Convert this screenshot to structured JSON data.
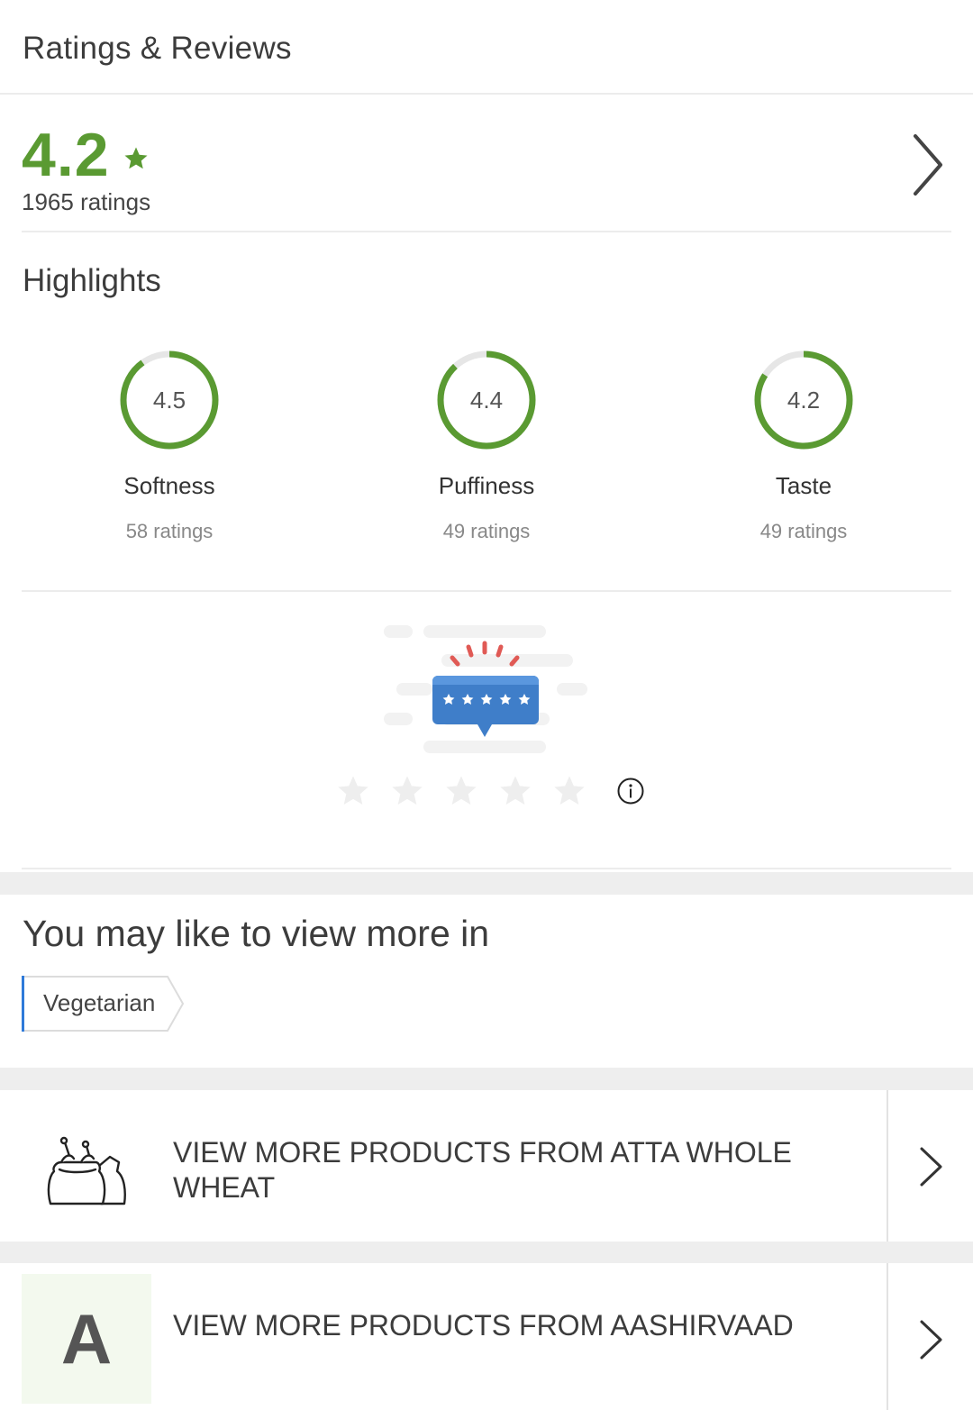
{
  "header": {
    "title": "Ratings & Reviews"
  },
  "overall": {
    "score": "4.2",
    "ratings_count": "1965 ratings",
    "star_icon": "star-icon",
    "chevron_icon": "chevron-right-icon"
  },
  "highlights": {
    "title": "Highlights",
    "items": [
      {
        "value": "4.5",
        "label": "Softness",
        "count": "58 ratings",
        "level": 0.9
      },
      {
        "value": "4.4",
        "label": "Puffiness",
        "count": "49 ratings",
        "level": 0.88
      },
      {
        "value": "4.2",
        "label": "Taste",
        "count": "49 ratings",
        "level": 0.84
      }
    ]
  },
  "rate": {
    "illustration_icon": "rating-bubble-icon",
    "stars": 5,
    "selected": 0,
    "info_icon": "info-icon"
  },
  "more": {
    "title": "You may like to view more in",
    "tag": "Vegetarian"
  },
  "links": [
    {
      "icon": "flour-sack-icon",
      "text": "VIEW MORE PRODUCTS FROM ATTA WHOLE WHEAT"
    },
    {
      "icon_letter": "A",
      "text": "VIEW MORE PRODUCTS FROM AASHIRVAAD"
    }
  ],
  "colors": {
    "accent_green": "#5a9a32",
    "ring_track": "#e6e6e6",
    "tag_accent": "#2f7ad9",
    "bubble_blue": "#3f7ec9",
    "spark_red": "#e05a55"
  }
}
